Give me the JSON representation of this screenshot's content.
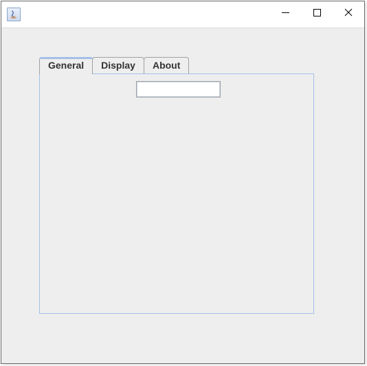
{
  "window": {
    "title": ""
  },
  "tabs": [
    {
      "label": "General"
    },
    {
      "label": "Display"
    },
    {
      "label": "About"
    }
  ],
  "general_panel": {
    "text_value": ""
  }
}
